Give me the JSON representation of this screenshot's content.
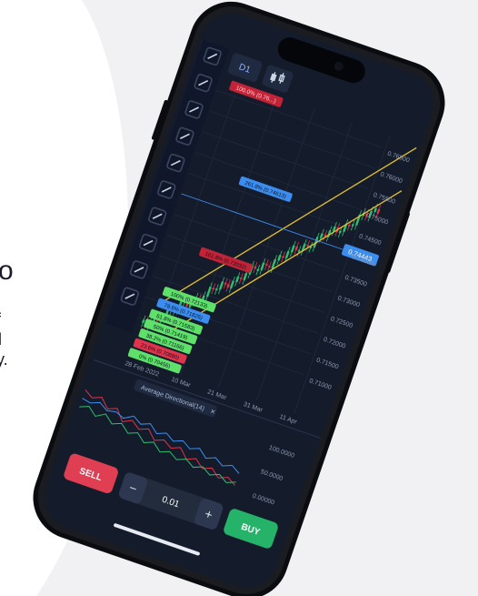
{
  "edge_fragments": {
    "a": "o",
    "b": "f",
    "c": "ll",
    "d": "y."
  },
  "toolbar": {
    "timeframe": "D1",
    "icons": [
      "crosshair-icon",
      "magnet-icon",
      "vertical-line-icon",
      "horizontal-line-icon",
      "trend-line-icon",
      "channel-icon",
      "brush-icon",
      "fx-icon",
      "settings-icon",
      "play-icon"
    ]
  },
  "chart": {
    "top_label": "100.0% (0.76...)",
    "price_levels": [
      "0.76500",
      "0.76000",
      "0.75500",
      "0.75000",
      "0.74500",
      "0.74000",
      "0.73500",
      "0.73000",
      "0.72500",
      "0.72000",
      "0.71500",
      "0.71000"
    ],
    "current_price": "0.74443",
    "fib_labels": [
      "261.8% (0.74613)",
      "161.8% (0.73032)",
      "100% (0.72133)",
      "78.6% (0.71826)",
      "61.8% (0.71583)",
      "50% (0.71419)",
      "38.2% (0.71166)",
      "23.6% (0.70880)",
      "0% (0.70456)"
    ],
    "dates": [
      "28 Feb 2022",
      "10 Mar",
      "21 Mar",
      "31 Mar",
      "11 Apr"
    ],
    "indicator_title": "Average Directional(14)",
    "indicator_levels": [
      "100.0000",
      "50.0000",
      "0.00000"
    ]
  },
  "colors": {
    "bull": "#2fbf71",
    "bear": "#e0334c",
    "trend": "#e6c229",
    "accent": "#3b8ef0",
    "screen": "#141c2b"
  },
  "trade": {
    "sell_label": "SELL",
    "buy_label": "BUY",
    "minus": "−",
    "plus": "+",
    "lot": "0.01"
  }
}
